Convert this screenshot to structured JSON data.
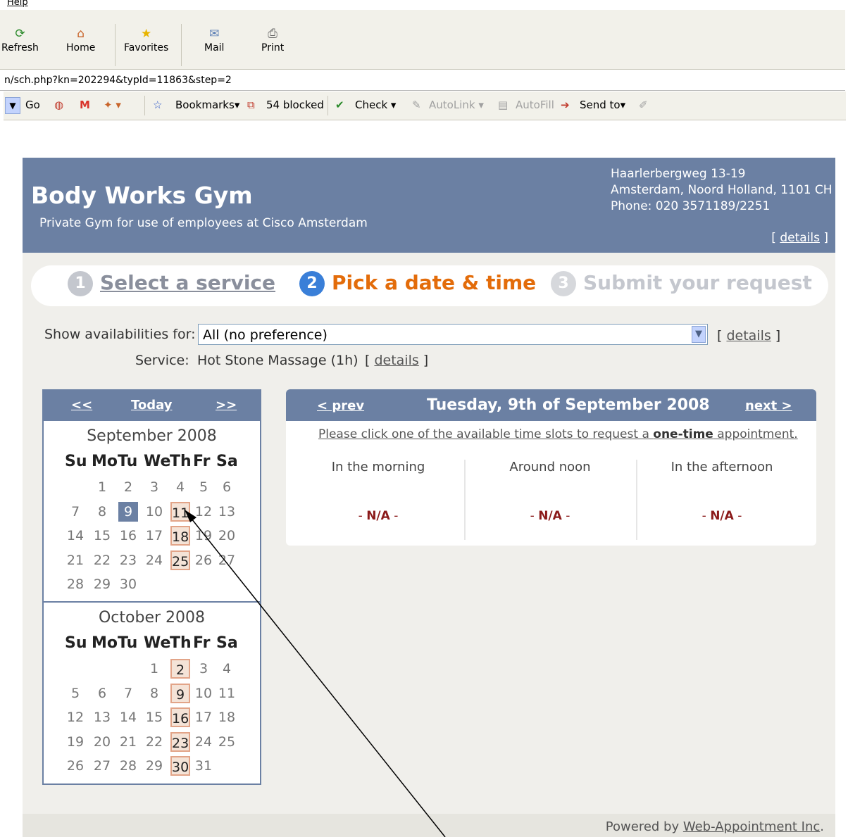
{
  "browser": {
    "menu_help": "Help",
    "toolbar": [
      {
        "label": "Refresh",
        "icon": "refresh-icon"
      },
      {
        "label": "Home",
        "icon": "home-icon"
      },
      {
        "label": "Favorites",
        "icon": "star-icon"
      },
      {
        "label": "Mail",
        "icon": "mail-icon"
      },
      {
        "label": "Print",
        "icon": "printer-icon"
      }
    ],
    "url": "n/sch.php?kn=202294&typId=11863&step=2",
    "googlebar": {
      "go": "Go",
      "bookmarks": "Bookmarks",
      "blocked": "54 blocked",
      "check": "Check",
      "autolink": "AutoLink",
      "autofill": "AutoFill",
      "sendto": "Send to"
    }
  },
  "header": {
    "title": "Body Works Gym",
    "subtitle": "Private Gym for use of employees at Cisco Amsterdam",
    "address_line1": "Haarlerbergweg 13-19",
    "address_line2": "Amsterdam, Noord Holland, 1101 CH",
    "phone": "Phone: 020 3571189/2251",
    "details_open": "[ ",
    "details_link": "details",
    "details_close": " ]"
  },
  "steps": [
    {
      "num": "1",
      "label": "Select a service"
    },
    {
      "num": "2",
      "label": "Pick a date & time"
    },
    {
      "num": "3",
      "label": "Submit your request"
    }
  ],
  "filters": {
    "show_label": "Show availabilities for:",
    "show_value": "All (no preference)",
    "show_details": "details",
    "service_label": "Service:",
    "service_value": "Hot Stone Massage (1h)",
    "service_details": "details"
  },
  "calendar": {
    "nav_prev": "<<",
    "nav_today": "Today",
    "nav_next": ">>",
    "weekdays": [
      "Su",
      "Mo",
      "Tu",
      "We",
      "Th",
      "Fr",
      "Sa"
    ],
    "months": [
      {
        "title": "September 2008",
        "weeks": [
          [
            "",
            "1",
            "2",
            "3",
            "4",
            "5",
            "6"
          ],
          [
            "7",
            "8",
            "9",
            "10",
            "11",
            "12",
            "13"
          ],
          [
            "14",
            "15",
            "16",
            "17",
            "18",
            "19",
            "20"
          ],
          [
            "21",
            "22",
            "23",
            "24",
            "25",
            "26",
            "27"
          ],
          [
            "28",
            "29",
            "30",
            "",
            "",
            "",
            ""
          ]
        ],
        "selected": [
          "9"
        ],
        "available": [
          "11",
          "18",
          "25"
        ]
      },
      {
        "title": "October 2008",
        "weeks": [
          [
            "",
            "",
            "",
            "1",
            "2",
            "3",
            "4"
          ],
          [
            "5",
            "6",
            "7",
            "8",
            "9",
            "10",
            "11"
          ],
          [
            "12",
            "13",
            "14",
            "15",
            "16",
            "17",
            "18"
          ],
          [
            "19",
            "20",
            "21",
            "22",
            "23",
            "24",
            "25"
          ],
          [
            "26",
            "27",
            "28",
            "29",
            "30",
            "31",
            ""
          ]
        ],
        "selected": [],
        "available": [
          "2",
          "9",
          "16",
          "23",
          "30"
        ]
      }
    ]
  },
  "day_panel": {
    "prev": "< prev",
    "date": "Tuesday, 9th of September 2008",
    "next": "next >",
    "instruction_pre": "Please click one of the available time slots to request a ",
    "instruction_bold": "one-time",
    "instruction_post": " appointment.",
    "columns": [
      {
        "label": "In the morning",
        "na_pre": "- ",
        "na": "N/A",
        "na_post": " -"
      },
      {
        "label": "Around noon",
        "na_pre": "- ",
        "na": "N/A",
        "na_post": " -"
      },
      {
        "label": "In the afternoon",
        "na_pre": "- ",
        "na": "N/A",
        "na_post": " -"
      }
    ]
  },
  "footer": {
    "powered_by": "Powered by ",
    "link": "Web-Appointment Inc",
    "dot": "."
  },
  "colors": {
    "header_blue": "#6b80a3",
    "step_active": "#e36c0a",
    "step_num_active": "#3a7fd8",
    "available_day_border": "#e2a488",
    "na_red": "#8b1a1a"
  }
}
